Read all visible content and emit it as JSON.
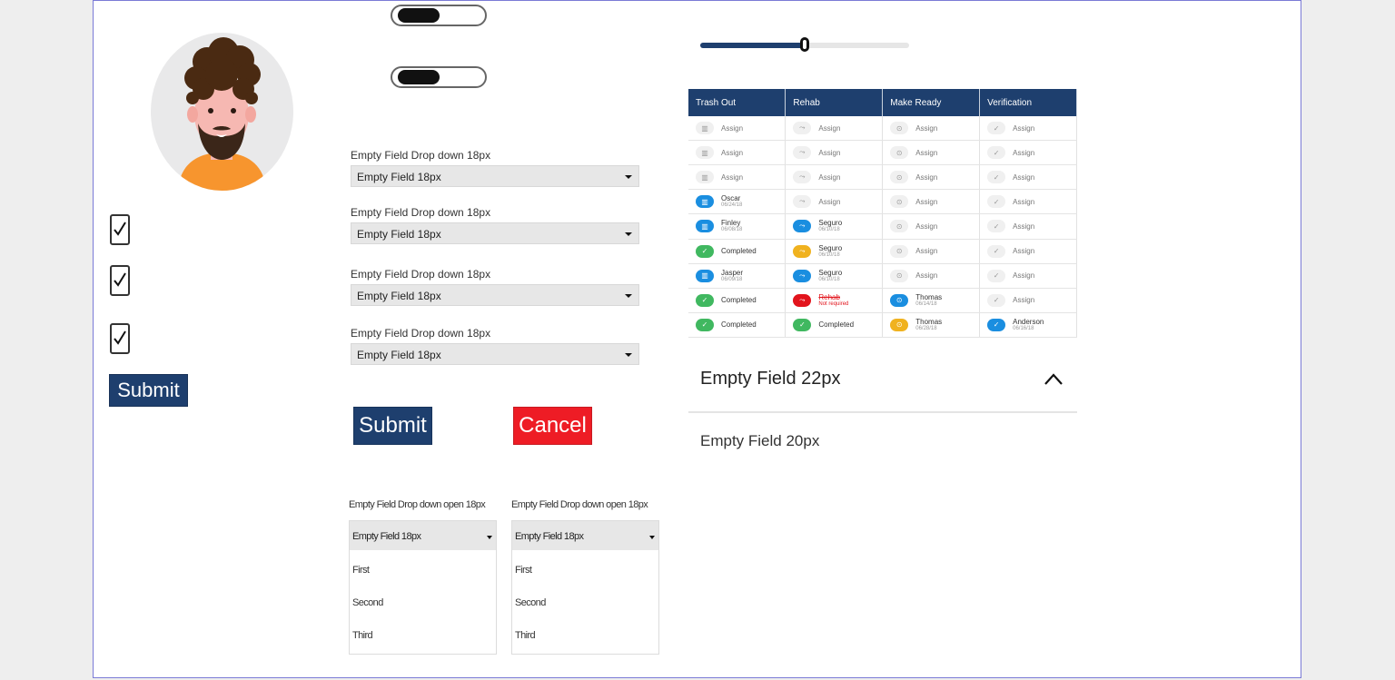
{
  "form": {
    "submit_label": "Submit"
  },
  "dropdowns": [
    {
      "label": "Empty Field Drop down 18px",
      "value": "Empty Field 18px"
    },
    {
      "label": "Empty Field Drop down 18px",
      "value": "Empty Field 18px"
    },
    {
      "label": "Empty Field Drop down 18px",
      "value": "Empty Field 18px"
    },
    {
      "label": "Empty Field Drop down 18px",
      "value": "Empty Field 18px"
    }
  ],
  "buttons": {
    "submit": "Submit",
    "cancel": "Cancel"
  },
  "open_dropdowns": [
    {
      "label": "Empty Field Drop down open 18px",
      "value": "Empty Field 18px",
      "options": [
        "First",
        "Second",
        "Third"
      ]
    },
    {
      "label": "Empty Field Drop down open 18px",
      "value": "Empty Field 18px",
      "options": [
        "First",
        "Second",
        "Third"
      ]
    }
  ],
  "slider": {
    "value_fraction": 0.5
  },
  "table": {
    "headers": [
      "Trash Out",
      "Rehab",
      "Make Ready",
      "Verification"
    ],
    "assign": "Assign",
    "rows": [
      [
        {
          "name": "Assign"
        },
        {
          "name": "Assign"
        },
        {
          "name": "Assign"
        },
        {
          "name": "Assign"
        }
      ],
      [
        {
          "name": "Assign"
        },
        {
          "name": "Assign"
        },
        {
          "name": "Assign"
        },
        {
          "name": "Assign"
        }
      ],
      [
        {
          "name": "Assign"
        },
        {
          "name": "Assign"
        },
        {
          "name": "Assign"
        },
        {
          "name": "Assign"
        }
      ],
      [
        {
          "name": "Oscar",
          "date": "06/24/18",
          "color": "blue"
        },
        {
          "name": "Assign"
        },
        {
          "name": "Assign"
        },
        {
          "name": "Assign"
        }
      ],
      [
        {
          "name": "Finley",
          "date": "06/08/18",
          "color": "blue"
        },
        {
          "name": "Seguro",
          "date": "06/10/18",
          "color": "blue"
        },
        {
          "name": "Assign"
        },
        {
          "name": "Assign"
        }
      ],
      [
        {
          "name": "Completed",
          "color": "green"
        },
        {
          "name": "Seguro",
          "date": "06/10/18",
          "color": "yellow"
        },
        {
          "name": "Assign"
        },
        {
          "name": "Assign"
        }
      ],
      [
        {
          "name": "Jasper",
          "date": "06/09/18",
          "color": "blue"
        },
        {
          "name": "Seguro",
          "date": "06/10/18",
          "color": "blue"
        },
        {
          "name": "Assign"
        },
        {
          "name": "Assign"
        }
      ],
      [
        {
          "name": "Completed",
          "color": "green"
        },
        {
          "name": "Rehab",
          "note": "Not required",
          "color": "red"
        },
        {
          "name": "Thomas",
          "date": "06/14/18",
          "color": "blue"
        },
        {
          "name": "Assign"
        }
      ],
      [
        {
          "name": "Completed",
          "color": "green"
        },
        {
          "name": "Completed",
          "color": "green"
        },
        {
          "name": "Thomas",
          "date": "06/28/18",
          "color": "yellow"
        },
        {
          "name": "Anderson",
          "date": "06/16/18",
          "color": "blue"
        }
      ]
    ]
  },
  "accordion": {
    "title": "Empty Field 22px",
    "body": "Empty Field 20px"
  },
  "colors": {
    "primary": "#1e3f6e",
    "danger": "#ee1c25",
    "success": "#40b860",
    "info": "#1a8ee0",
    "warning": "#f0b21f"
  }
}
